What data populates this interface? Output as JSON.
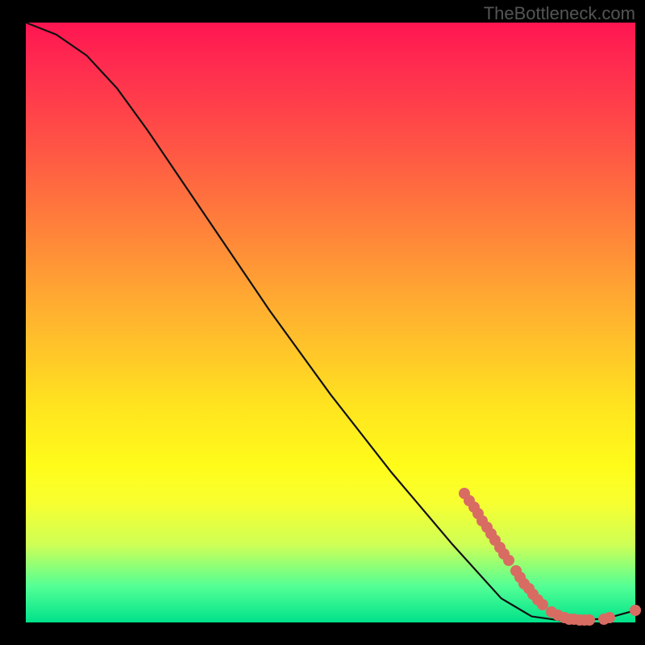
{
  "watermark": "TheBottleneck.com",
  "chart_data": {
    "type": "line",
    "title": "",
    "xlabel": "",
    "ylabel": "",
    "xlim": [
      0,
      100
    ],
    "ylim": [
      0,
      100
    ],
    "curve": [
      {
        "x": 0,
        "y": 100
      },
      {
        "x": 5,
        "y": 98
      },
      {
        "x": 10,
        "y": 94.5
      },
      {
        "x": 15,
        "y": 89
      },
      {
        "x": 20,
        "y": 82
      },
      {
        "x": 30,
        "y": 67
      },
      {
        "x": 40,
        "y": 52
      },
      {
        "x": 50,
        "y": 38
      },
      {
        "x": 60,
        "y": 25
      },
      {
        "x": 70,
        "y": 13
      },
      {
        "x": 78,
        "y": 4
      },
      {
        "x": 83,
        "y": 1
      },
      {
        "x": 88,
        "y": 0.3
      },
      {
        "x": 95,
        "y": 0.6
      },
      {
        "x": 100,
        "y": 2
      }
    ],
    "scatter": [
      {
        "x": 72,
        "y": 21.5
      },
      {
        "x": 72.8,
        "y": 20.3
      },
      {
        "x": 73.5,
        "y": 19.2
      },
      {
        "x": 74.2,
        "y": 18.1
      },
      {
        "x": 74.9,
        "y": 17.0
      },
      {
        "x": 75.6,
        "y": 15.9
      },
      {
        "x": 76.3,
        "y": 14.8
      },
      {
        "x": 77.0,
        "y": 13.7
      },
      {
        "x": 77.8,
        "y": 12.5
      },
      {
        "x": 78.5,
        "y": 11.4
      },
      {
        "x": 79.2,
        "y": 10.3
      },
      {
        "x": 80.4,
        "y": 8.6
      },
      {
        "x": 81.1,
        "y": 7.5
      },
      {
        "x": 81.8,
        "y": 6.5
      },
      {
        "x": 82.5,
        "y": 5.6
      },
      {
        "x": 83.2,
        "y": 4.7
      },
      {
        "x": 84.0,
        "y": 3.8
      },
      {
        "x": 84.8,
        "y": 3.0
      },
      {
        "x": 86.3,
        "y": 1.8
      },
      {
        "x": 87.3,
        "y": 1.2
      },
      {
        "x": 88.3,
        "y": 0.8
      },
      {
        "x": 89.1,
        "y": 0.6
      },
      {
        "x": 90.0,
        "y": 0.5
      },
      {
        "x": 90.9,
        "y": 0.4
      },
      {
        "x": 91.7,
        "y": 0.4
      },
      {
        "x": 92.5,
        "y": 0.4
      },
      {
        "x": 94.8,
        "y": 0.6
      },
      {
        "x": 95.8,
        "y": 0.8
      },
      {
        "x": 100.0,
        "y": 2.0
      }
    ],
    "colors": {
      "curve": "#111111",
      "point": "#d86c62",
      "gradient_top": "#ff1551",
      "gradient_mid": "#ffe41f",
      "gradient_bottom": "#00e28a"
    }
  }
}
